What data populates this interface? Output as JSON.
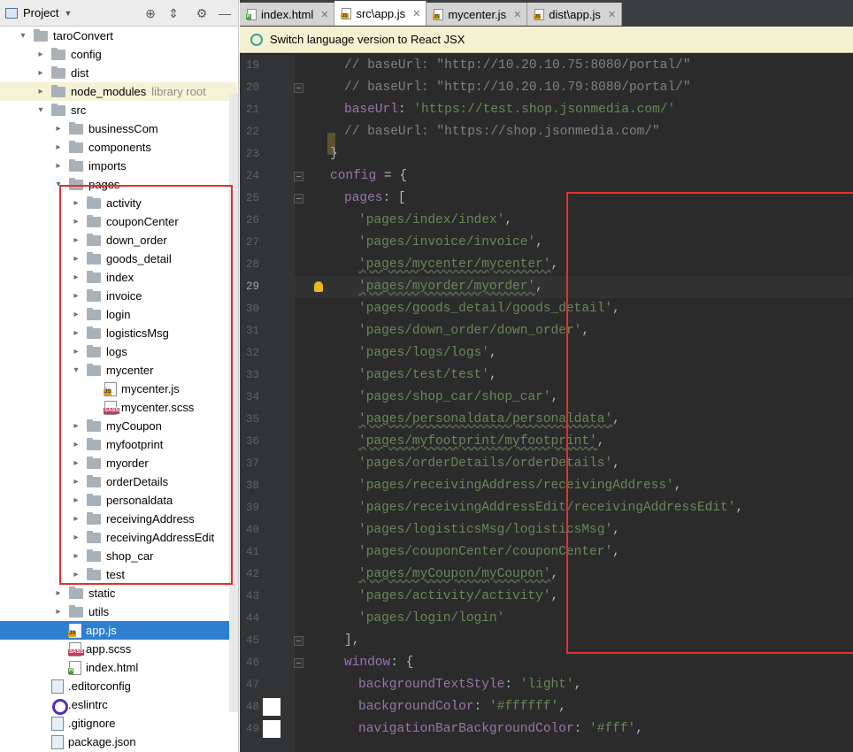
{
  "project_panel": {
    "title": "Project",
    "header_tools": [
      "target-icon",
      "collapse-icon",
      "gear-icon",
      "minimize-icon"
    ],
    "tree": [
      {
        "label": "taroConvert",
        "type": "folder",
        "state": "open"
      },
      {
        "label": "config",
        "type": "folder",
        "state": "closed"
      },
      {
        "label": "dist",
        "type": "folder",
        "state": "closed"
      },
      {
        "label": "node_modules",
        "type": "folder",
        "state": "closed",
        "extra": "library root"
      },
      {
        "label": "src",
        "type": "folder",
        "state": "open"
      },
      {
        "label": "businessCom",
        "type": "folder",
        "state": "closed"
      },
      {
        "label": "components",
        "type": "folder",
        "state": "closed"
      },
      {
        "label": "imports",
        "type": "folder",
        "state": "closed"
      },
      {
        "label": "pages",
        "type": "folder",
        "state": "open"
      },
      {
        "label": "activity",
        "type": "folder",
        "state": "closed"
      },
      {
        "label": "couponCenter",
        "type": "folder",
        "state": "closed"
      },
      {
        "label": "down_order",
        "type": "folder",
        "state": "closed"
      },
      {
        "label": "goods_detail",
        "type": "folder",
        "state": "closed"
      },
      {
        "label": "index",
        "type": "folder",
        "state": "closed"
      },
      {
        "label": "invoice",
        "type": "folder",
        "state": "closed"
      },
      {
        "label": "login",
        "type": "folder",
        "state": "closed"
      },
      {
        "label": "logisticsMsg",
        "type": "folder",
        "state": "closed"
      },
      {
        "label": "logs",
        "type": "folder",
        "state": "closed"
      },
      {
        "label": "mycenter",
        "type": "folder",
        "state": "open"
      },
      {
        "label": "mycenter.js",
        "type": "js"
      },
      {
        "label": "mycenter.scss",
        "type": "sass"
      },
      {
        "label": "myCoupon",
        "type": "folder",
        "state": "closed"
      },
      {
        "label": "myfootprint",
        "type": "folder",
        "state": "closed"
      },
      {
        "label": "myorder",
        "type": "folder",
        "state": "closed"
      },
      {
        "label": "orderDetails",
        "type": "folder",
        "state": "closed"
      },
      {
        "label": "personaldata",
        "type": "folder",
        "state": "closed"
      },
      {
        "label": "receivingAddress",
        "type": "folder",
        "state": "closed"
      },
      {
        "label": "receivingAddressEdit",
        "type": "folder",
        "state": "closed"
      },
      {
        "label": "shop_car",
        "type": "folder",
        "state": "closed"
      },
      {
        "label": "test",
        "type": "folder",
        "state": "closed"
      },
      {
        "label": "static",
        "type": "folder",
        "state": "closed"
      },
      {
        "label": "utils",
        "type": "folder",
        "state": "closed"
      },
      {
        "label": "app.js",
        "type": "js",
        "selected": true
      },
      {
        "label": "app.scss",
        "type": "sass"
      },
      {
        "label": "index.html",
        "type": "html"
      },
      {
        "label": ".editorconfig",
        "type": "cfg"
      },
      {
        "label": ".eslintrc",
        "type": "eslint"
      },
      {
        "label": ".gitignore",
        "type": "cfg"
      },
      {
        "label": "package.json",
        "type": "cfg"
      }
    ]
  },
  "tabs": [
    {
      "label": "index.html",
      "icon": "html"
    },
    {
      "label": "src\\app.js",
      "icon": "js",
      "active": true
    },
    {
      "label": "mycenter.js",
      "icon": "js"
    },
    {
      "label": "dist\\app.js",
      "icon": "js"
    }
  ],
  "banner": {
    "text": "Switch language version to React JSX"
  },
  "colors": {
    "selection": "#2f7fd0",
    "highlight_box": "#e52f2f",
    "editor_bg": "#2b2b2b",
    "string": "#6a8759",
    "comment": "#808080",
    "property": "#9876aa"
  },
  "editor": {
    "current_line": 29,
    "lines": [
      {
        "n": 19,
        "segs": [
          {
            "t": "// baseUrl: \"http://10.20.10.75:8080/portal/\"",
            "c": "c"
          }
        ]
      },
      {
        "n": 20,
        "segs": [
          {
            "t": "// baseUrl: \"http://10.20.10.79:8080/portal/\"",
            "c": "c"
          }
        ]
      },
      {
        "n": 21,
        "segs": [
          {
            "t": "baseUrl",
            "c": "k"
          },
          {
            "t": ": ",
            "c": ""
          },
          {
            "t": "'https://test.shop.jsonmedia.com/'",
            "c": "s"
          }
        ]
      },
      {
        "n": 22,
        "segs": [
          {
            "t": "// baseUrl: \"https://shop.jsonmedia.com/\"",
            "c": "c"
          }
        ]
      },
      {
        "n": 23,
        "segs": [
          {
            "t": "}",
            "c": ""
          }
        ]
      },
      {
        "n": 24,
        "segs": [
          {
            "t": "config",
            "c": "k"
          },
          {
            "t": " = {",
            "c": ""
          }
        ]
      },
      {
        "n": 25,
        "segs": [
          {
            "t": "pages",
            "c": "k"
          },
          {
            "t": ": [",
            "c": ""
          }
        ]
      },
      {
        "n": 26,
        "segs": [
          {
            "t": "'pages/index/index'",
            "c": "s"
          },
          {
            "t": ",",
            "c": ""
          }
        ]
      },
      {
        "n": 27,
        "segs": [
          {
            "t": "'pages/invoice/invoice'",
            "c": "s"
          },
          {
            "t": ",",
            "c": ""
          }
        ]
      },
      {
        "n": 28,
        "segs": [
          {
            "t": "'pages/mycenter/mycenter'",
            "c": "s"
          },
          {
            "t": ",",
            "c": ""
          }
        ]
      },
      {
        "n": 29,
        "segs": [
          {
            "t": "'pages/myorder/myorder'",
            "c": "s"
          },
          {
            "t": ",",
            "c": ""
          }
        ]
      },
      {
        "n": 30,
        "segs": [
          {
            "t": "'pages/goods_detail/goods_detail'",
            "c": "s"
          },
          {
            "t": ",",
            "c": ""
          }
        ]
      },
      {
        "n": 31,
        "segs": [
          {
            "t": "'pages/down_order/down_order'",
            "c": "s"
          },
          {
            "t": ",",
            "c": ""
          }
        ]
      },
      {
        "n": 32,
        "segs": [
          {
            "t": "'pages/logs/logs'",
            "c": "s"
          },
          {
            "t": ",",
            "c": ""
          }
        ]
      },
      {
        "n": 33,
        "segs": [
          {
            "t": "'pages/test/test'",
            "c": "s"
          },
          {
            "t": ",",
            "c": ""
          }
        ]
      },
      {
        "n": 34,
        "segs": [
          {
            "t": "'pages/shop_car/shop_car'",
            "c": "s"
          },
          {
            "t": ",",
            "c": ""
          }
        ]
      },
      {
        "n": 35,
        "segs": [
          {
            "t": "'pages/personaldata/personaldata'",
            "c": "s"
          },
          {
            "t": ",",
            "c": ""
          }
        ]
      },
      {
        "n": 36,
        "segs": [
          {
            "t": "'pages/myfootprint/myfootprint'",
            "c": "s"
          },
          {
            "t": ",",
            "c": ""
          }
        ]
      },
      {
        "n": 37,
        "segs": [
          {
            "t": "'pages/orderDetails/orderDetails'",
            "c": "s"
          },
          {
            "t": ",",
            "c": ""
          }
        ]
      },
      {
        "n": 38,
        "segs": [
          {
            "t": "'pages/receivingAddress/receivingAddress'",
            "c": "s"
          },
          {
            "t": ",",
            "c": ""
          }
        ]
      },
      {
        "n": 39,
        "segs": [
          {
            "t": "'pages/receivingAddressEdit/receivingAddressEdit'",
            "c": "s"
          },
          {
            "t": ",",
            "c": ""
          }
        ]
      },
      {
        "n": 40,
        "segs": [
          {
            "t": "'pages/logisticsMsg/logisticsMsg'",
            "c": "s"
          },
          {
            "t": ",",
            "c": ""
          }
        ]
      },
      {
        "n": 41,
        "segs": [
          {
            "t": "'pages/couponCenter/couponCenter'",
            "c": "s"
          },
          {
            "t": ",",
            "c": ""
          }
        ]
      },
      {
        "n": 42,
        "segs": [
          {
            "t": "'pages/myCoupon/myCoupon'",
            "c": "s"
          },
          {
            "t": ",",
            "c": ""
          }
        ]
      },
      {
        "n": 43,
        "segs": [
          {
            "t": "'pages/activity/activity'",
            "c": "s"
          },
          {
            "t": ",",
            "c": ""
          }
        ]
      },
      {
        "n": 44,
        "segs": [
          {
            "t": "'pages/login/login'",
            "c": "s"
          }
        ]
      },
      {
        "n": 45,
        "segs": [
          {
            "t": "],",
            "c": ""
          }
        ]
      },
      {
        "n": 46,
        "segs": [
          {
            "t": "window",
            "c": "k"
          },
          {
            "t": ": {",
            "c": ""
          }
        ]
      },
      {
        "n": 47,
        "segs": [
          {
            "t": "backgroundTextStyle",
            "c": "k"
          },
          {
            "t": ": ",
            "c": ""
          },
          {
            "t": "'light'",
            "c": "s"
          },
          {
            "t": ",",
            "c": ""
          }
        ]
      },
      {
        "n": 48,
        "segs": [
          {
            "t": "backgroundColor",
            "c": "k"
          },
          {
            "t": ": ",
            "c": ""
          },
          {
            "t": "'#ffffff'",
            "c": "s"
          },
          {
            "t": ",",
            "c": ""
          }
        ]
      },
      {
        "n": 49,
        "segs": [
          {
            "t": "navigationBarBackgroundColor",
            "c": "k"
          },
          {
            "t": ": ",
            "c": ""
          },
          {
            "t": "'#fff'",
            "c": "s"
          },
          {
            "t": ",",
            "c": ""
          }
        ]
      }
    ]
  }
}
